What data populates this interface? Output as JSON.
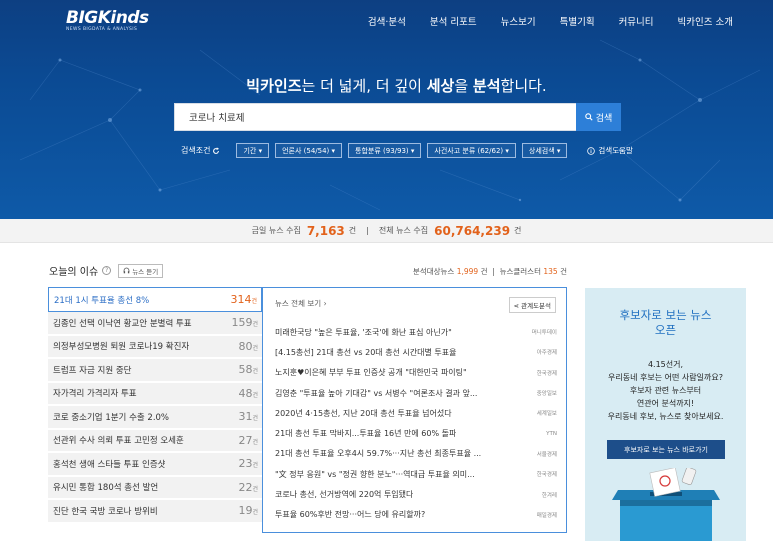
{
  "header": {
    "logo_main": "BIGKinds",
    "logo_sub": "NEWS BIGDATA & ANALYSIS",
    "nav": [
      "검색·분석",
      "분석 리포트",
      "뉴스보기",
      "특별기획",
      "커뮤니티",
      "빅카인즈 소개"
    ]
  },
  "hero": {
    "slogan_brand": "빅카인즈",
    "slogan_mid1": "는 더 넓게, 더 깊이 ",
    "slogan_strong": "세상",
    "slogan_mid2": "을 ",
    "slogan_strong2": "분석",
    "slogan_end": "합니다."
  },
  "search": {
    "value": "코로나 치료제",
    "button_label": "검색"
  },
  "filters": {
    "label": "검색조건",
    "items": [
      "기간",
      "언론사 (54/54)",
      "통합분류 (93/93)",
      "사건사고 분류 (62/62)",
      "상세검색"
    ],
    "help": "검색도움말"
  },
  "stats": {
    "today_label": "금일 뉴스 수집",
    "today_value": "7,163",
    "unit": "건",
    "total_label": "전체 뉴스 수집",
    "total_value": "60,764,239"
  },
  "issues": {
    "title": "오늘의 이슈",
    "help": "?",
    "listen_label": "뉴스 듣기",
    "analysis_label": "분석대상뉴스",
    "analysis_value": "1,999",
    "cluster_label": "뉴스클러스터",
    "cluster_value": "135",
    "unit": "건",
    "items": [
      {
        "title": "21대 1시 투표율 총선 8%",
        "count": "314",
        "unit": "건"
      },
      {
        "title": "김종인 선택 이낙연 황교안 분별력 투표",
        "count": "159",
        "unit": "건"
      },
      {
        "title": "의정부성모병원 퇴원 코로나19 확진자",
        "count": "80",
        "unit": "건"
      },
      {
        "title": "트럼프 자금 지원 중단",
        "count": "58",
        "unit": "건"
      },
      {
        "title": "자가격리 가격리자 투표",
        "count": "48",
        "unit": "건"
      },
      {
        "title": "코로 중소기업 1분기 수출 2.0%",
        "count": "31",
        "unit": "건"
      },
      {
        "title": "선관위 수사 의뢰 투표 고민정 오세훈",
        "count": "27",
        "unit": "건"
      },
      {
        "title": "홍석천 생애 스타들 투표 인증샷",
        "count": "23",
        "unit": "건"
      },
      {
        "title": "유시민 통합 180석 총선 발언",
        "count": "22",
        "unit": "건"
      },
      {
        "title": "진단 한국 국방 코로나 방위비",
        "count": "19",
        "unit": "건"
      }
    ]
  },
  "news_panel": {
    "all_label": "뉴스 전체 보기",
    "relation_label": "관계도분석",
    "items": [
      {
        "title": "미래한국당 \"높은 투표율, '조국'에 화난 표심 아닌가\"",
        "source": "머니투데이"
      },
      {
        "title": "[4.15총선] 21대 총선 vs 20대 총선 시간대별 투표율",
        "source": "아주경제"
      },
      {
        "title": "노지훈♥이은혜 부부 투표 인증샷 공개 \"대한민국 파이팅\"",
        "source": "한국경제"
      },
      {
        "title": "김영춘 \"투표율 높아 기대감\" vs 서병수 \"여론조사 결과 앞...",
        "source": "중앙일보"
      },
      {
        "title": "2020년 4·15총선, 지난 20대 총선 투표율 넘어섰다",
        "source": "세계일보"
      },
      {
        "title": "21대 총선 투표 막바지...투표율 16년 만에 60% 돌파",
        "source": "YTN"
      },
      {
        "title": "21대 총선 투표율 오후4시 59.7%···지난 총선 최종투표율 ...",
        "source": "서울경제"
      },
      {
        "title": "\"文 정부 응원\" vs \"정권 향한 분노\"···역대급 투표율 의미...",
        "source": "한국경제"
      },
      {
        "title": "코로나 총선, 선거방역에 220억 투입됐다",
        "source": "한겨레"
      },
      {
        "title": "투표율 60%후반 전망···어느 당에 유리할까?",
        "source": "매일경제"
      }
    ]
  },
  "promo": {
    "title_line1": "후보자로 보는 뉴스",
    "title_line2": "오픈",
    "text_lines": [
      "4.15선거,",
      "우리동네 후보는 어떤 사람일까요?",
      "후보자 관련 뉴스부터",
      "연관어 분석까지!",
      "우리동네 후보, 뉴스로 찾아보세요."
    ],
    "button_label": "후보자로 보는 뉴스 바로가기"
  },
  "colors": {
    "hero_bg": "#0b4a93",
    "accent_blue": "#2d7fd8",
    "accent_orange": "#e2621b",
    "promo_bg": "#d8ecf3",
    "promo_btn": "#1d4e8a"
  }
}
